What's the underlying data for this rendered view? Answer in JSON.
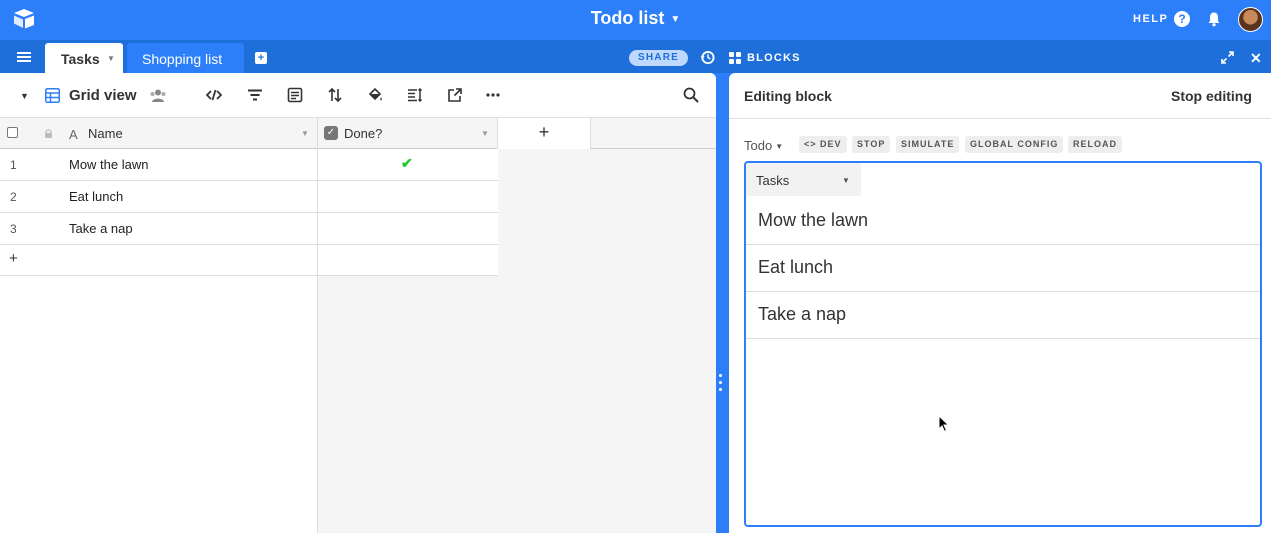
{
  "app": {
    "title": "Todo list",
    "help_label": "HELP",
    "share_label": "SHARE",
    "blocks_label": "BLOCKS"
  },
  "tabs": [
    {
      "label": "Tasks",
      "active": true
    },
    {
      "label": "Shopping list",
      "active": false
    }
  ],
  "toolbar": {
    "view_name": "Grid view",
    "icons": [
      "people-icon",
      "code-icon",
      "filter-icon",
      "group-icon",
      "sort-icon",
      "color-icon",
      "row-height-icon",
      "share-view-icon",
      "more-icon",
      "search-icon"
    ]
  },
  "grid": {
    "columns": [
      {
        "name": "Name",
        "type": "text"
      },
      {
        "name": "Done?",
        "type": "checkbox"
      }
    ],
    "add_field_label": "+",
    "add_row_label": "+",
    "rows": [
      {
        "num": "1",
        "name": "Mow the lawn",
        "done": true,
        "done_mark": "✔"
      },
      {
        "num": "2",
        "name": "Eat lunch",
        "done": false,
        "done_mark": ""
      },
      {
        "num": "3",
        "name": "Take a nap",
        "done": false,
        "done_mark": ""
      }
    ]
  },
  "block_panel": {
    "title": "Editing block",
    "stop_label": "Stop editing",
    "block_name": "Todo",
    "dev_chips": [
      "DEV",
      "STOP",
      "SIMULATE",
      "GLOBAL CONFIG",
      "RELOAD"
    ],
    "table_select": "Tasks",
    "items": [
      "Mow the lawn",
      "Eat lunch",
      "Take a nap"
    ]
  },
  "colors": {
    "brand_blue": "#2d7ff9",
    "tab_bar": "#1e6fd9",
    "check_green": "#20c933"
  }
}
